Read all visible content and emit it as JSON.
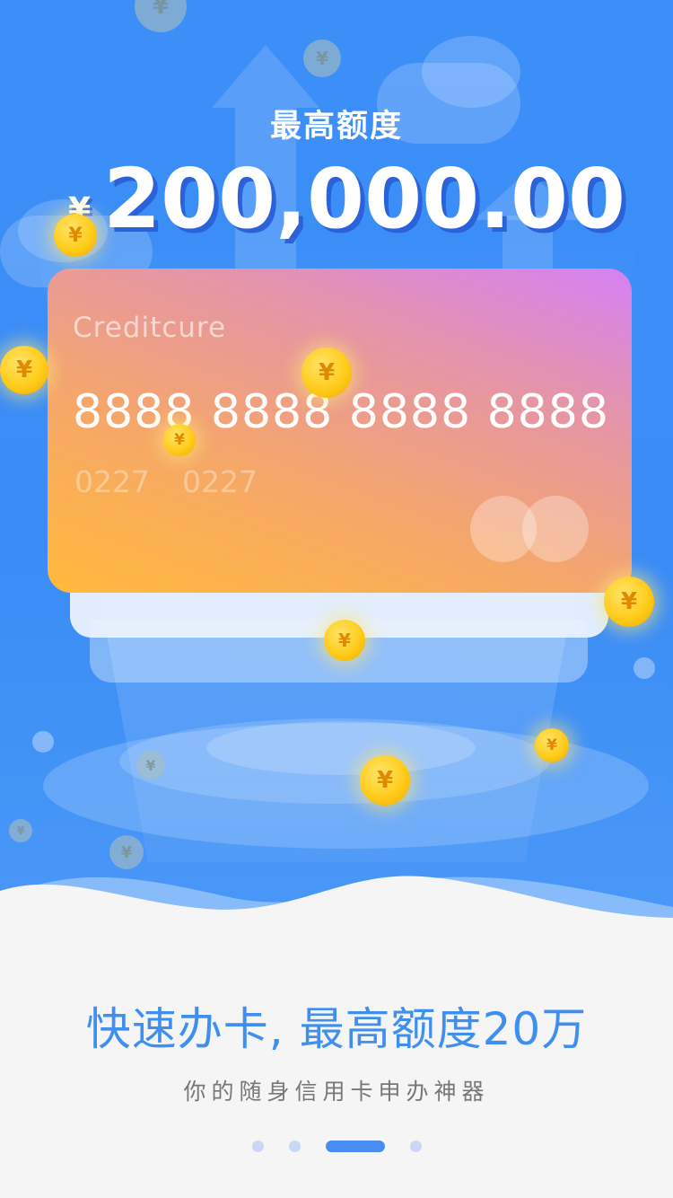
{
  "hero": {
    "label": "最高额度",
    "currency_symbol": "¥",
    "amount": "200,000.00"
  },
  "card": {
    "brand": "Creditcure",
    "number": "8888 8888 8888 8888",
    "date_left": "0227",
    "date_right": "0227"
  },
  "coin_glyph": "¥",
  "headline": "快速办卡, 最高额度20万",
  "subline": "你的随身信用卡申办神器",
  "pager": {
    "pages": 4,
    "active_index": 2
  },
  "colors": {
    "primary_blue": "#3d8ff8",
    "headline_blue": "#3f8ff0",
    "card_gradient_start": "#ffba3b",
    "card_gradient_end": "#d581f5",
    "coin_gold": "#ffcc1a",
    "pager_active": "#4a8df2",
    "pager_inactive": "#c8d8f4"
  }
}
